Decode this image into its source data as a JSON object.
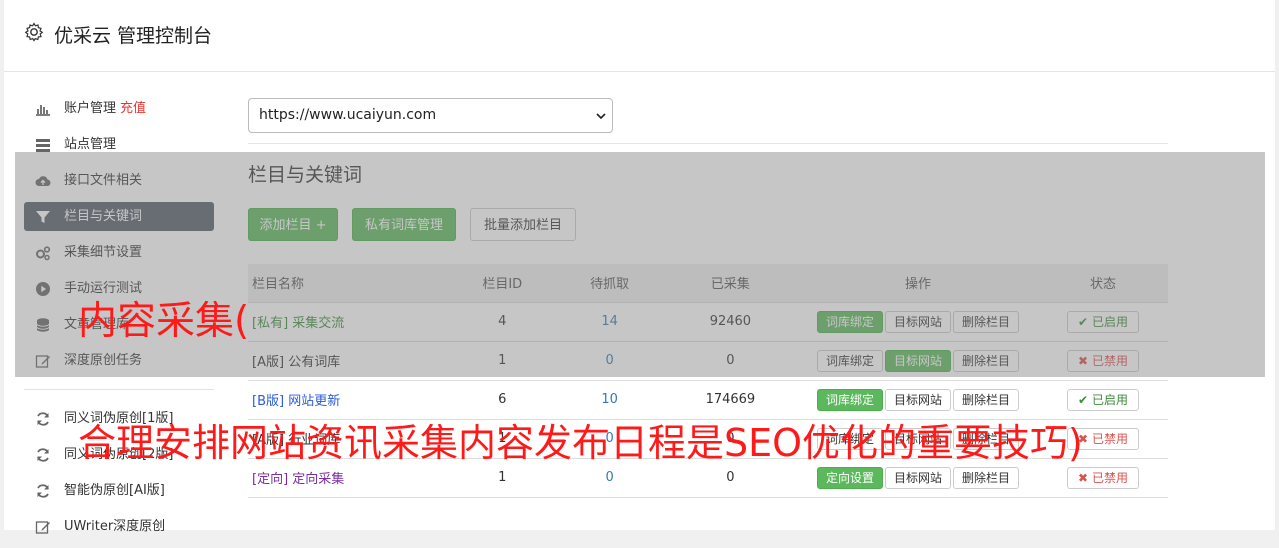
{
  "header": {
    "title": "优采云 管理控制台"
  },
  "sidebar": {
    "items": [
      {
        "label": "账户管理",
        "extra": "充值",
        "icon": "bar-chart-icon"
      },
      {
        "label": "站点管理",
        "icon": "server-icon"
      },
      {
        "label": "接口文件相关",
        "icon": "cloud-upload-icon"
      },
      {
        "label": "栏目与关键词",
        "icon": "filter-icon",
        "active": true
      },
      {
        "label": "采集细节设置",
        "icon": "cogs-icon"
      },
      {
        "label": "手动运行测试",
        "icon": "play-circle-icon"
      },
      {
        "label": "文章管理库",
        "icon": "database-icon"
      },
      {
        "label": "深度原创任务",
        "icon": "edit-icon"
      }
    ],
    "items2": [
      {
        "label": "同义词伪原创[1版]",
        "icon": "refresh-icon"
      },
      {
        "label": "同义词伪原创[2版]",
        "icon": "refresh-icon"
      },
      {
        "label": "智能伪原创[AI版]",
        "icon": "refresh-icon"
      },
      {
        "label": "UWriter深度原创",
        "icon": "edit-icon"
      }
    ]
  },
  "main": {
    "site_select": "https://www.ucaiyun.com",
    "section_title": "栏目与关键词",
    "buttons": {
      "add_column": "添加栏目 +",
      "private_lexicon": "私有词库管理",
      "batch_add": "批量添加栏目"
    },
    "table": {
      "headers": [
        "栏目名称",
        "栏目ID",
        "待抓取",
        "已采集",
        "操作",
        "状态"
      ],
      "rows": [
        {
          "tag": "[私有]",
          "name": "采集交流",
          "id": "4",
          "pending": "14",
          "collected": "92460",
          "op1": "词库绑定",
          "op2": "目标网站",
          "op3": "删除栏目",
          "status": "已启用",
          "ok": true
        },
        {
          "tag": "[A版]",
          "name": "公有词库",
          "id": "1",
          "pending": "0",
          "collected": "0",
          "op1": "词库绑定",
          "op2": "目标网站",
          "op3": "删除栏目",
          "status": "已禁用",
          "ok": false
        },
        {
          "tag": "[B版]",
          "name": "网站更新",
          "id": "6",
          "pending": "10",
          "collected": "174669",
          "op1": "词库绑定",
          "op2": "目标网站",
          "op3": "删除栏目",
          "status": "已启用",
          "ok": true
        },
        {
          "tag": "[A版]",
          "name": "行业词库",
          "id": "1",
          "pending": "0",
          "collected": "0",
          "op1": "词库绑定",
          "op2": "目标网站",
          "op3": "删除栏目",
          "status": "已禁用",
          "ok": false
        },
        {
          "tag": "[定向]",
          "name": "定向采集",
          "id": "1",
          "pending": "0",
          "collected": "0",
          "op1": "定向设置",
          "op2": "目标网站",
          "op3": "删除栏目",
          "status": "已禁用",
          "ok": false
        }
      ]
    }
  },
  "watermark": {
    "line1": "内容采集(",
    "line2": "合理安排网站资讯采集内容发布日程是SEO优化的重要技巧)"
  },
  "colors": {
    "accent_green": "#5cb85c",
    "active_nav": "#555d6b",
    "watermark_red": "#ff1a1a"
  }
}
